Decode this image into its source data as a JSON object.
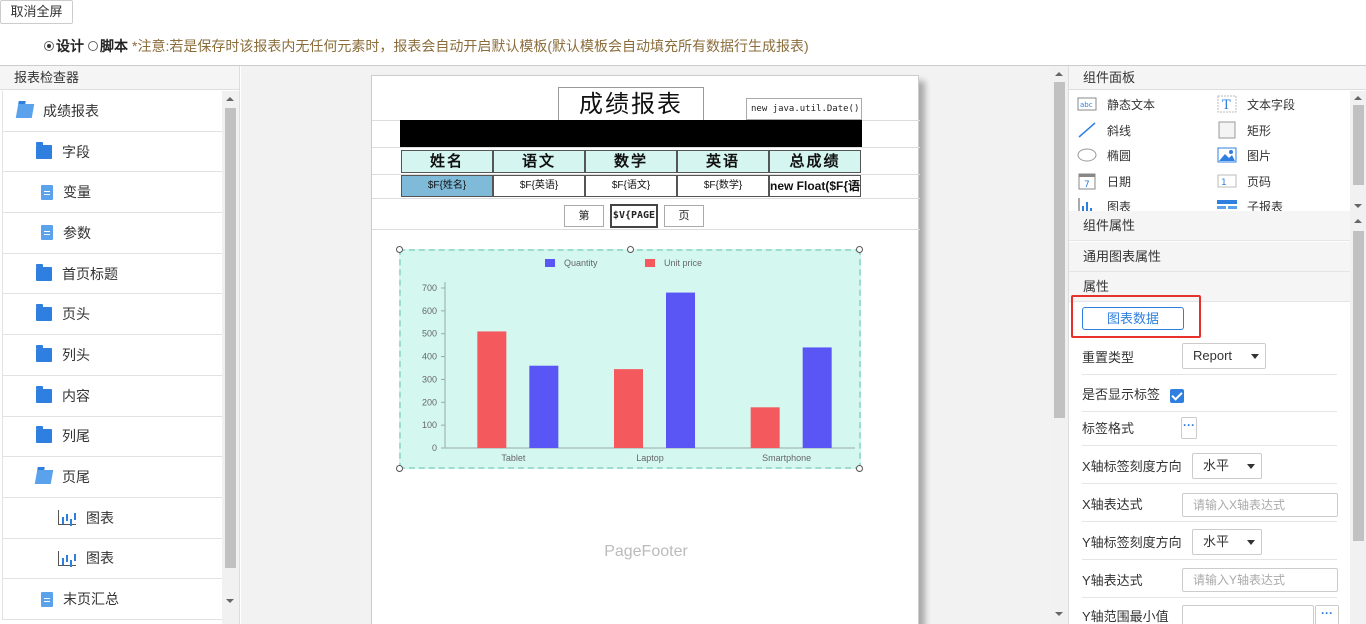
{
  "topbar": {
    "exit_fullscreen": "取消全屏",
    "mode_design": "设计",
    "mode_script": "脚本",
    "note": "*注意:若是保存时该报表内无任何元素时，报表会自动开启默认模板(默认模板会自动填充所有数据行生成报表)"
  },
  "inspector": {
    "title": "报表检查器",
    "items": [
      {
        "label": "成绩报表",
        "icon": "folder-open-icon"
      },
      {
        "label": "字段",
        "icon": "folder-icon"
      },
      {
        "label": "变量",
        "icon": "file-icon"
      },
      {
        "label": "参数",
        "icon": "file-icon"
      },
      {
        "label": "首页标题",
        "icon": "folder-icon"
      },
      {
        "label": "页头",
        "icon": "folder-icon"
      },
      {
        "label": "列头",
        "icon": "folder-icon"
      },
      {
        "label": "内容",
        "icon": "folder-icon"
      },
      {
        "label": "列尾",
        "icon": "folder-icon"
      },
      {
        "label": "页尾",
        "icon": "folder-open-icon"
      },
      {
        "label": "图表",
        "icon": "chart-icon"
      },
      {
        "label": "图表",
        "icon": "chart-icon"
      },
      {
        "label": "末页汇总",
        "icon": "file-icon"
      }
    ]
  },
  "report": {
    "title": "成绩报表",
    "date_expr": "new java.util.Date()",
    "headers": [
      "姓名",
      "语文",
      "数学",
      "英语",
      "总成绩"
    ],
    "row": [
      "$F{姓名}",
      "$F{英语}",
      "$F{语文}",
      "$F{数学}",
      "new Float($F{语"
    ],
    "page_prefix": "第",
    "page_expr": "$V{PAGE",
    "page_suffix": "页",
    "page_footer": "PageFooter"
  },
  "chart_data": {
    "type": "bar",
    "categories": [
      "Tablet",
      "Laptop",
      "Smartphone"
    ],
    "series": [
      {
        "name": "Quantity",
        "values": [
          360,
          680,
          440
        ],
        "color": "#5a55f5"
      },
      {
        "name": "Unit price",
        "values": [
          510,
          345,
          178
        ],
        "color": "#f45a5d"
      }
    ],
    "ylim": [
      0,
      700
    ],
    "yticks": [
      0,
      100,
      200,
      300,
      400,
      500,
      600,
      700
    ],
    "legend": "top-center",
    "background": "#d4f8f0",
    "grid": false
  },
  "components": {
    "title": "组件面板",
    "items": [
      {
        "label": "静态文本",
        "icon": "static-text-icon"
      },
      {
        "label": "文本字段",
        "icon": "text-field-icon"
      },
      {
        "label": "斜线",
        "icon": "line-icon"
      },
      {
        "label": "矩形",
        "icon": "rectangle-icon"
      },
      {
        "label": "椭圆",
        "icon": "ellipse-icon"
      },
      {
        "label": "图片",
        "icon": "image-icon"
      },
      {
        "label": "日期",
        "icon": "date-icon"
      },
      {
        "label": "页码",
        "icon": "page-number-icon"
      },
      {
        "label": "图表",
        "icon": "chart-icon"
      },
      {
        "label": "子报表",
        "icon": "subreport-icon"
      }
    ],
    "static_text_icon_text": "abc",
    "text_field_icon_text": "T",
    "date_icon_text": "7",
    "page_number_icon_text": "1"
  },
  "properties": {
    "component_props": "组件属性",
    "general_chart_props": "通用图表属性",
    "props": "属性",
    "chart_data_button": "图表数据",
    "reset_type_label": "重置类型",
    "reset_type_value": "Report",
    "show_labels_label": "是否显示标签",
    "label_format_label": "标签格式",
    "x_tick_dir_label": "X轴标签刻度方向",
    "x_tick_dir_value": "水平",
    "x_expr_label": "X轴表达式",
    "x_expr_placeholder": "请输入X轴表达式",
    "y_tick_dir_label": "Y轴标签刻度方向",
    "y_tick_dir_value": "水平",
    "y_expr_label": "Y轴表达式",
    "y_expr_placeholder": "请输入Y轴表达式",
    "y_min_label": "Y轴范围最小值",
    "dots": "···"
  },
  "colors": {
    "accent": "#2f7fe0",
    "highlight_red": "#e8302c",
    "header_cell": "#d4f5f0",
    "selected_cell": "#7fbbd9"
  }
}
